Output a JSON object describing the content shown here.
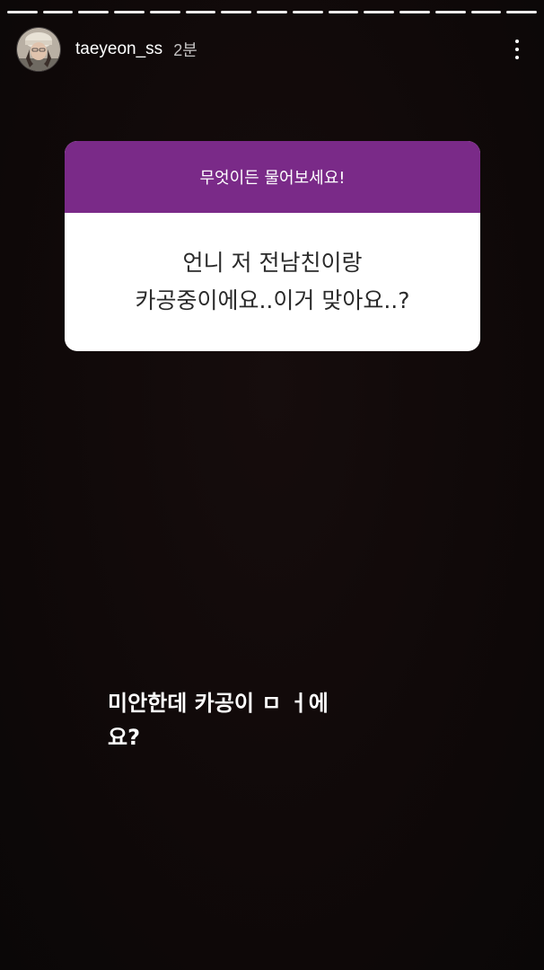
{
  "story": {
    "progress_segments": 15,
    "progress_active_index": 14
  },
  "header": {
    "username": "taeyeon_ss",
    "timestamp": "2분",
    "avatar_icon": "profile-photo",
    "more_icon": "vertical-ellipsis-icon"
  },
  "question_card": {
    "prompt": "무엇이든 물어보세요!",
    "question_lines": [
      "언니 저 전남친이랑",
      "카공중이에요..이거 맞아요..?"
    ],
    "header_color": "#7a2a88"
  },
  "answer": {
    "lines": [
      "미안한데 카공이 ㅁ ㅓ에",
      "요?"
    ]
  }
}
